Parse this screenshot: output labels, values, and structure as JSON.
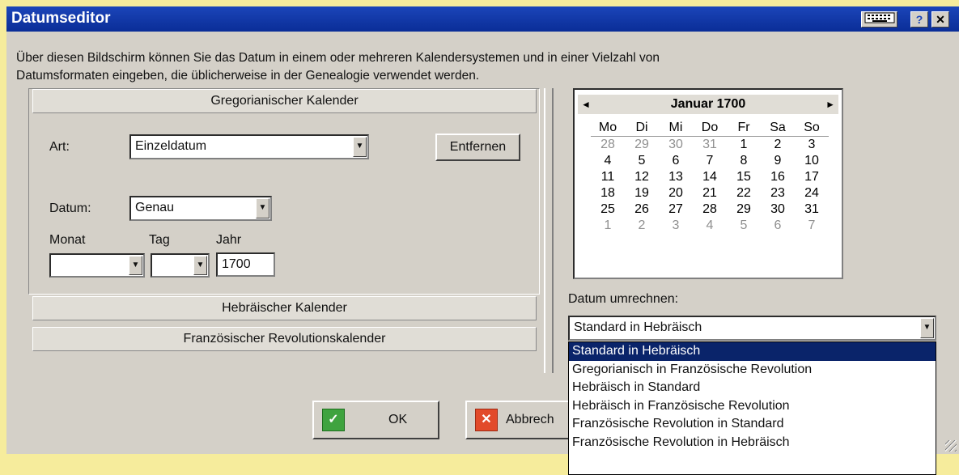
{
  "window": {
    "title": "Datumseditor",
    "help_label": "?",
    "close_label": "✕"
  },
  "intro_line1": "Über diesen Bildschirm können Sie das Datum in einem oder mehreren Kalendersystemen und in einer Vielzahl von",
  "intro_line2": "Datumsformaten eingeben, die üblicherweise in der Genealogie verwendet werden.",
  "tabs": [
    {
      "label": "Gregorianischer Kalender"
    },
    {
      "label": "Hebräischer Kalender"
    },
    {
      "label": "Französischer Revolutionskalender"
    }
  ],
  "form": {
    "art_label": "Art:",
    "art_value": "Einzeldatum",
    "remove_label": "Entfernen",
    "datum_label": "Datum:",
    "datum_value": "Genau",
    "monat_label": "Monat",
    "tag_label": "Tag",
    "jahr_label": "Jahr",
    "monat_value": "",
    "tag_value": "",
    "jahr_value": "1700"
  },
  "calendar": {
    "title": "Januar 1700",
    "prev": "◄",
    "next": "►",
    "weekdays": [
      "Mo",
      "Di",
      "Mi",
      "Do",
      "Fr",
      "Sa",
      "So"
    ],
    "weeks": [
      [
        "28",
        "29",
        "30",
        "31",
        "1",
        "2",
        "3"
      ],
      [
        "4",
        "5",
        "6",
        "7",
        "8",
        "9",
        "10"
      ],
      [
        "11",
        "12",
        "13",
        "14",
        "15",
        "16",
        "17"
      ],
      [
        "18",
        "19",
        "20",
        "21",
        "22",
        "23",
        "24"
      ],
      [
        "25",
        "26",
        "27",
        "28",
        "29",
        "30",
        "31"
      ],
      [
        "1",
        "2",
        "3",
        "4",
        "5",
        "6",
        "7"
      ]
    ]
  },
  "convert": {
    "label": "Datum umrechnen:",
    "value": "Standard in Hebräisch",
    "options": [
      "Standard in Hebräisch",
      "Gregorianisch in Französische Revolution",
      "Hebräisch in Standard",
      "Hebräisch in Französische Revolution",
      "Französische Revolution in Standard",
      "Französische Revolution in Hebräisch"
    ]
  },
  "buttons": {
    "ok_label": "OK",
    "cancel_label": "Abbrech"
  }
}
